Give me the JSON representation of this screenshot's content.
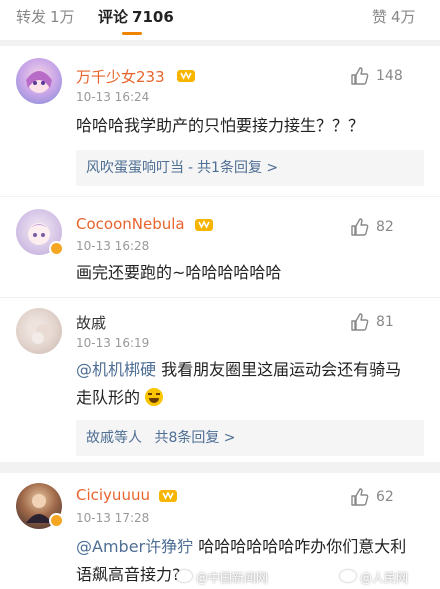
{
  "tabs": {
    "repost": {
      "label": "转发",
      "count": "1万"
    },
    "comments": {
      "label": "评论",
      "count": "7106"
    },
    "likes": {
      "label": "赞",
      "count": "4万"
    }
  },
  "comments": [
    {
      "username": "万千少女233",
      "time": "10-13 16:24",
      "likes": "148",
      "text": "哈哈哈我学助产的只怕要接力接生？？？",
      "reply": {
        "preview": "风吹蛋蛋响叮当",
        "count_label": "共1条回复 >"
      }
    },
    {
      "username": "CocoonNebula",
      "time": "10-13 16:28",
      "likes": "82",
      "text": "画完还要跑的~哈哈哈哈哈哈"
    },
    {
      "username": "故戚",
      "time": "10-13 16:19",
      "likes": "81",
      "mention": "@机机梆硬",
      "text": "我看朋友圈里这届运动会还有骑马走队形的",
      "reply": {
        "preview": "故戚等人",
        "count_label": "共8条回复 >"
      }
    },
    {
      "username": "Ciciyuuuu",
      "time": "10-13 17:28",
      "likes": "62",
      "mention": "@Amber许狰狞",
      "text": "哈哈哈哈哈哈咋办你们意大利语飙高音接力?"
    }
  ],
  "watermarks": {
    "left": "@中国新闻网",
    "right": "@人民网"
  },
  "colors": {
    "accent": "#f08300",
    "link": "#4e6e94",
    "vip_name": "#e8642c"
  }
}
